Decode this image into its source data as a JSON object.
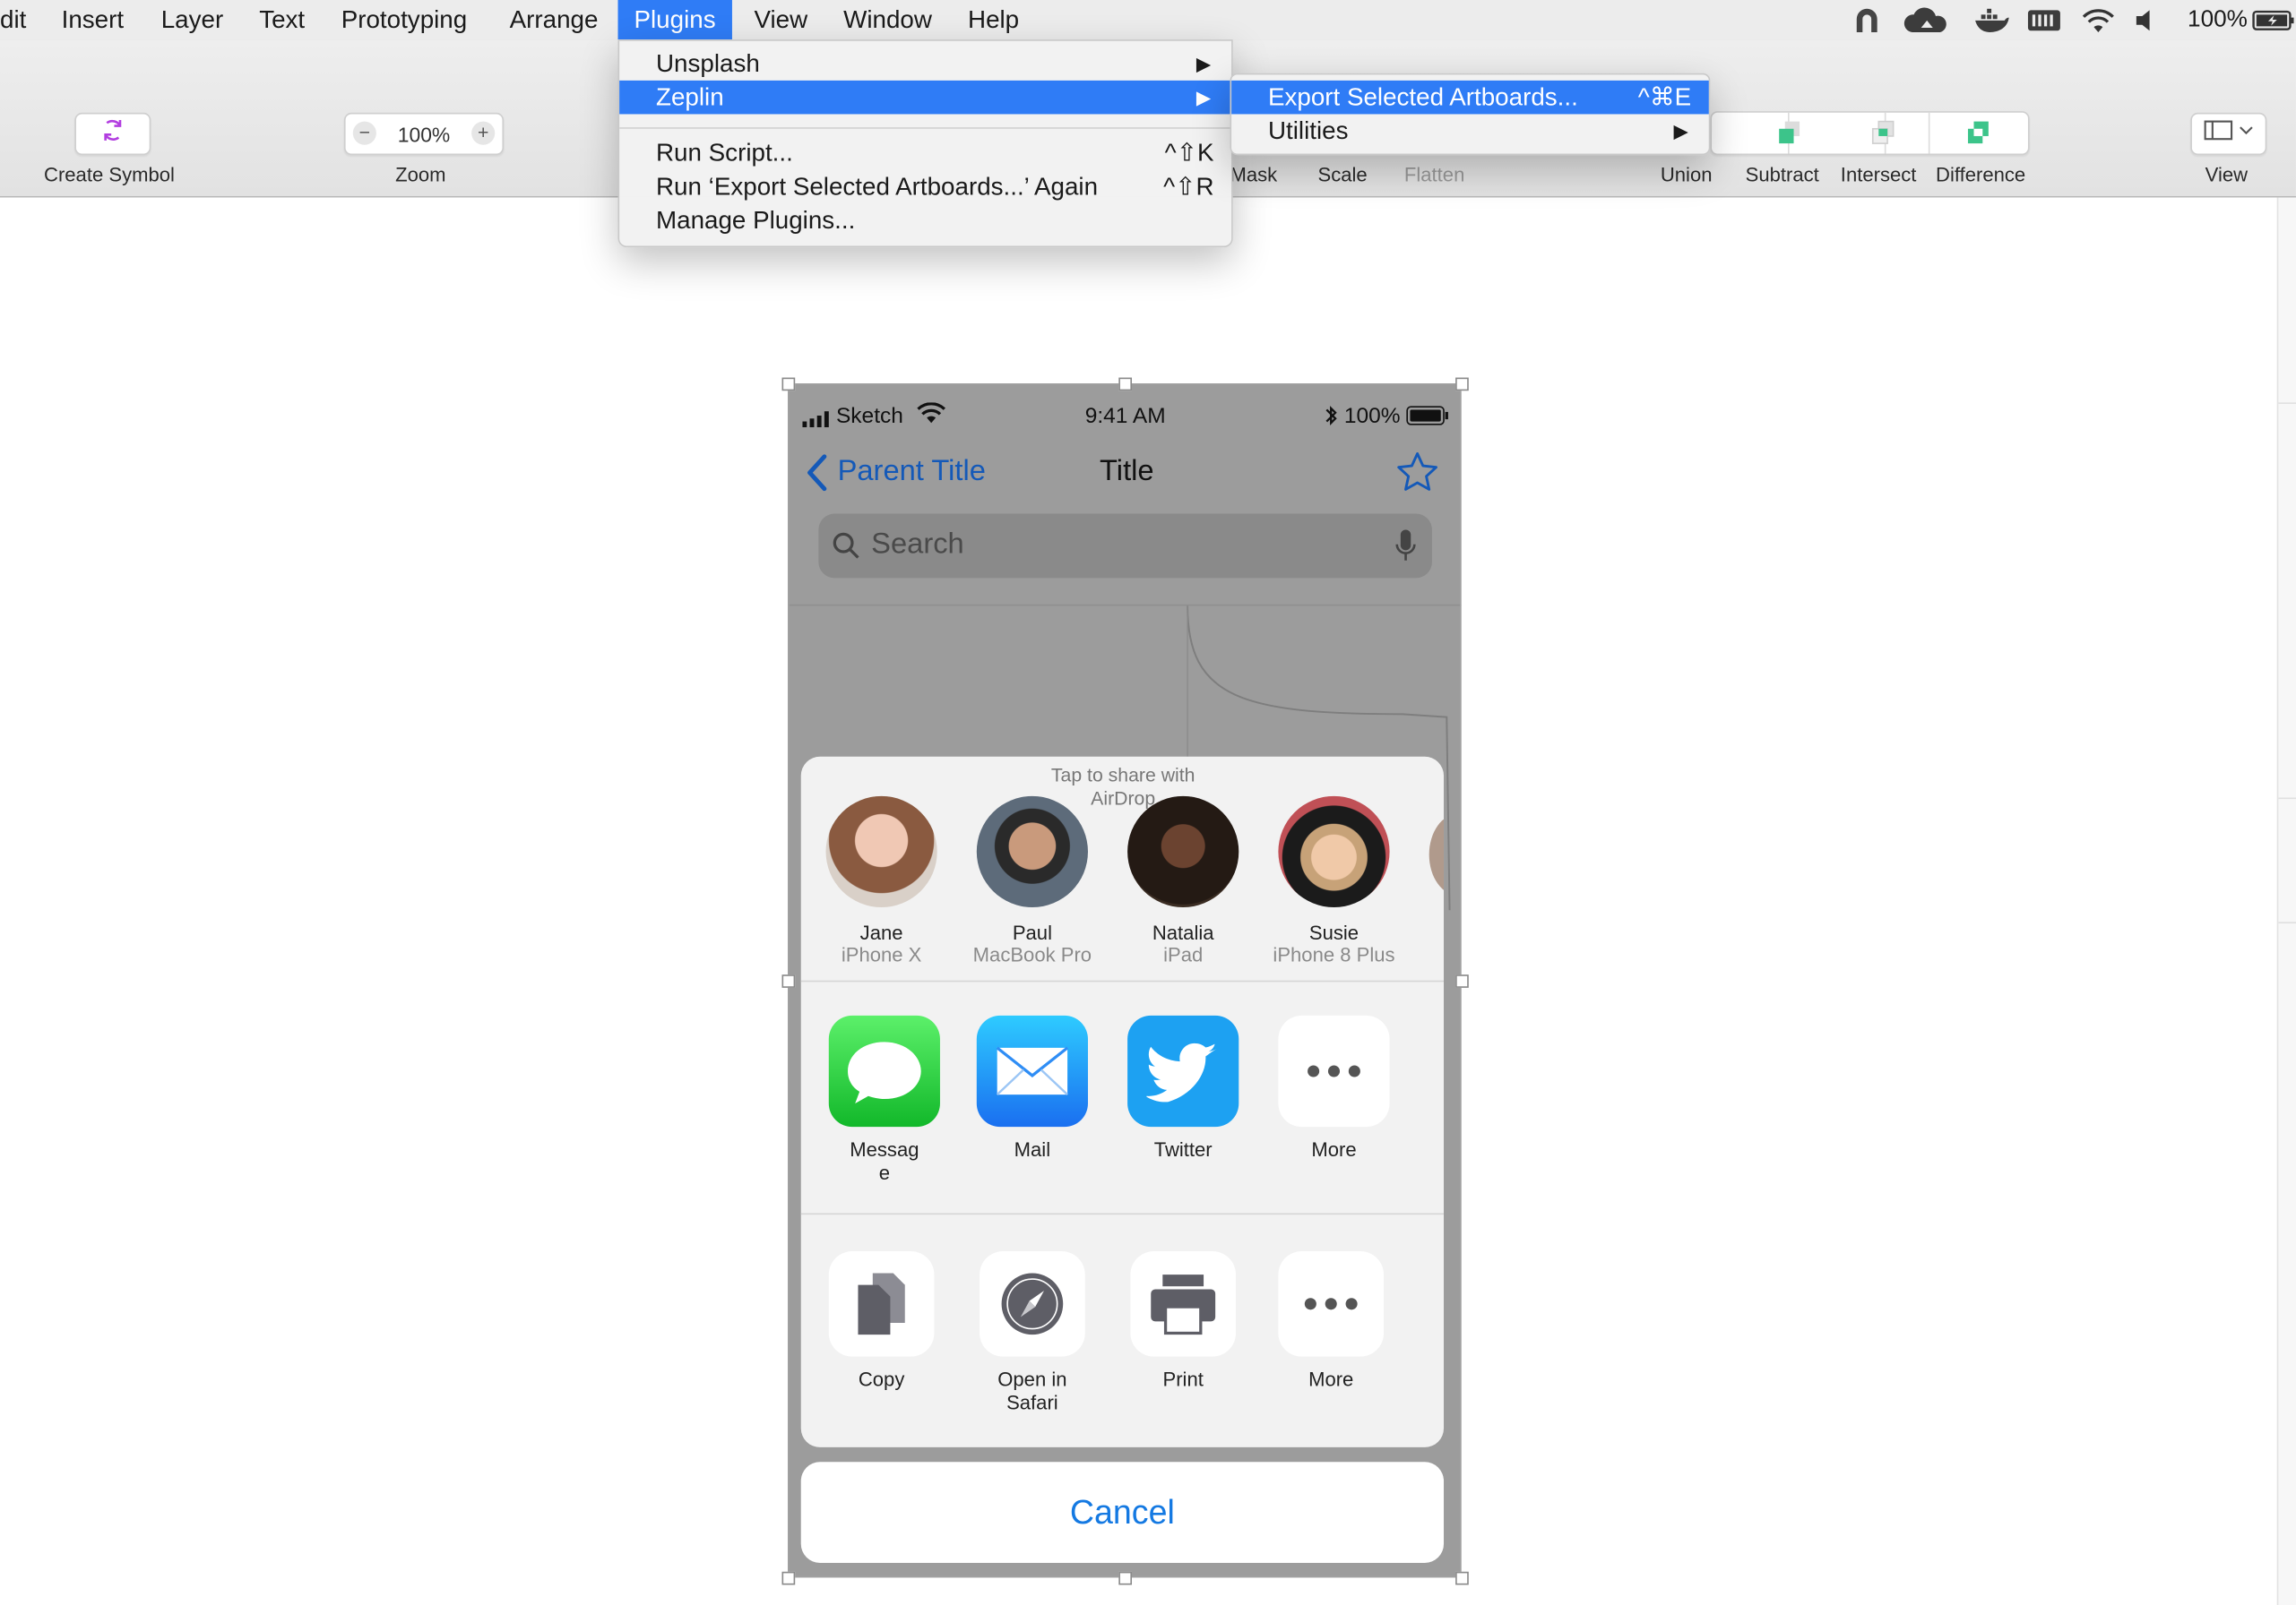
{
  "menubar": {
    "items": [
      "dit",
      "Insert",
      "Layer",
      "Text",
      "Prototyping",
      "Arrange",
      "Plugins",
      "View",
      "Window",
      "Help"
    ],
    "active": "Plugins",
    "status": {
      "battery": "100%"
    }
  },
  "toolbar": {
    "create_symbol": "Create Symbol",
    "zoom_value": "100%",
    "zoom_label": "Zoom",
    "mask": "Mask",
    "scale": "Scale",
    "flatten": "Flatten",
    "union": "Union",
    "subtract": "Subtract",
    "intersect": "Intersect",
    "difference": "Difference",
    "view": "View"
  },
  "plugins_menu": {
    "items": [
      {
        "label": "Unsplash",
        "submenu": true
      },
      {
        "label": "Zeplin",
        "submenu": true,
        "highlighted": true
      },
      {
        "label": "Run Script...",
        "shortcut": "^⇧K"
      },
      {
        "label": "Run ‘Export Selected Artboards...’ Again",
        "shortcut": "^⇧R"
      },
      {
        "label": "Manage Plugins..."
      }
    ]
  },
  "zeplin_submenu": {
    "items": [
      {
        "label": "Export Selected Artboards...",
        "shortcut": "^⌘E",
        "highlighted": true
      },
      {
        "label": "Utilities",
        "submenu": true
      }
    ]
  },
  "artboard": {
    "status_bar": {
      "carrier": "Sketch",
      "time": "9:41 AM",
      "battery": "100%"
    },
    "nav": {
      "back": "Parent Title",
      "title": "Title"
    },
    "search": {
      "placeholder": "Search"
    },
    "share_sheet": {
      "airdrop_hint": "Tap to share with AirDrop",
      "people": [
        {
          "name": "Jane",
          "device": "iPhone X"
        },
        {
          "name": "Paul",
          "device": "MacBook Pro"
        },
        {
          "name": "Natalia",
          "device": "iPad"
        },
        {
          "name": "Susie",
          "device": "iPhone 8 Plus"
        }
      ],
      "apps": [
        "Messag e",
        "Mail",
        "Twitter",
        "More"
      ],
      "actions": [
        "Copy",
        "Open in Safari",
        "Print",
        "More"
      ],
      "cancel": "Cancel"
    }
  },
  "colors": {
    "accent": "#2f7cf6",
    "ios_blue": "#1479e2",
    "messages": "#28c840",
    "twitter": "#1da1f2"
  }
}
